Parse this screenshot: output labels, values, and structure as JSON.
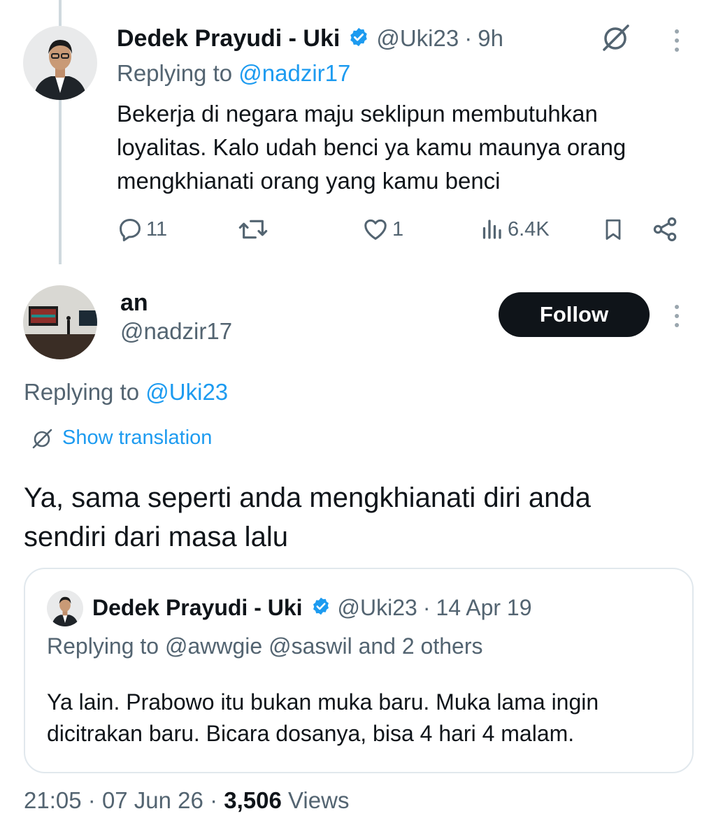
{
  "parent_tweet": {
    "author_name": "Dedek Prayudi - Uki",
    "handle": "@Uki23",
    "separator": "·",
    "time": "9h",
    "replying_prefix": "Replying to",
    "replying_handle": "@nadzir17",
    "text_line1": "Bekerja di negara maju seklipun membutuhkan",
    "text_line2": "loyalitas. Kalo udah benci ya kamu maunya orang",
    "text_line3": "mengkhianati orang yang kamu benci",
    "replies": "11",
    "likes": "1",
    "views": "6.4K"
  },
  "reply_tweet": {
    "author_name": "an",
    "handle": "@nadzir17",
    "follow_label": "Follow",
    "replying_prefix": "Replying to",
    "replying_handle": "@Uki23",
    "show_translation": "Show translation",
    "text_line1": "Ya, sama seperti anda mengkhianati diri anda",
    "text_line2": "sendiri dari masa lalu"
  },
  "quoted_tweet": {
    "author_name": "Dedek Prayudi - Uki",
    "handle": "@Uki23",
    "separator": "·",
    "date": "14 Apr 19",
    "replying_text": "Replying to @awwgie @saswil and 2 others",
    "text_line1": "Ya lain. Prabowo itu bukan muka baru. Muka lama ingin",
    "text_line2": "dicitrakan baru. Bicara dosanya, bisa 4 hari 4 malam."
  },
  "footer": {
    "time": "21:05",
    "separator": "·",
    "date": "07 Jun 26",
    "views_count": "3,506",
    "views_label": "Views"
  },
  "icons": {
    "verified": "verified-badge-icon",
    "grok": "grok-icon",
    "more": "more-options-icon",
    "reply": "reply-icon",
    "retweet": "retweet-icon",
    "like": "like-icon",
    "views": "views-icon",
    "bookmark": "bookmark-icon",
    "share": "share-icon",
    "translate": "translate-icon"
  },
  "colors": {
    "accent": "#1d9bf0",
    "text": "#0f1419",
    "secondary": "#536471",
    "button": "#0f1419"
  }
}
